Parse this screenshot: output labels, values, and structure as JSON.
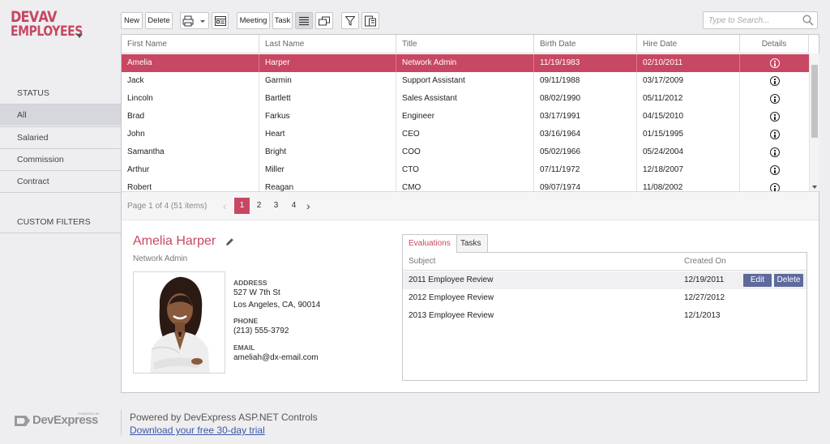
{
  "logo": {
    "line1_a": "DEV",
    "line1_b": "AV",
    "line2": "EMPLOYEES"
  },
  "sidebar": {
    "status_heading": "STATUS",
    "items": [
      {
        "label": "All",
        "active": true
      },
      {
        "label": "Salaried",
        "active": false
      },
      {
        "label": "Commission",
        "active": false
      },
      {
        "label": "Contract",
        "active": false
      }
    ],
    "custom_filters_heading": "CUSTOM FILTERS"
  },
  "toolbar": {
    "new_label": "New",
    "delete_label": "Delete",
    "meeting_label": "Meeting",
    "task_label": "Task"
  },
  "search": {
    "placeholder": "Type to Search..."
  },
  "grid": {
    "columns": [
      "First Name",
      "Last Name",
      "Title",
      "Birth Date",
      "Hire Date",
      "Details"
    ],
    "rows": [
      {
        "first": "Amelia",
        "last": "Harper",
        "title": "Network Admin",
        "birth": "11/19/1983",
        "hire": "02/10/2011",
        "selected": true
      },
      {
        "first": "Jack",
        "last": "Garmin",
        "title": "Support Assistant",
        "birth": "09/11/1988",
        "hire": "03/17/2009"
      },
      {
        "first": "Lincoln",
        "last": "Bartlett",
        "title": "Sales Assistant",
        "birth": "08/02/1990",
        "hire": "05/11/2012"
      },
      {
        "first": "Brad",
        "last": "Farkus",
        "title": "Engineer",
        "birth": "03/17/1991",
        "hire": "04/15/2010"
      },
      {
        "first": "John",
        "last": "Heart",
        "title": "CEO",
        "birth": "03/16/1964",
        "hire": "01/15/1995"
      },
      {
        "first": "Samantha",
        "last": "Bright",
        "title": "COO",
        "birth": "05/02/1966",
        "hire": "05/24/2004"
      },
      {
        "first": "Arthur",
        "last": "Miller",
        "title": "CTO",
        "birth": "07/11/1972",
        "hire": "12/18/2007"
      },
      {
        "first": "Robert",
        "last": "Reagan",
        "title": "CMO",
        "birth": "09/07/1974",
        "hire": "11/08/2002"
      }
    ]
  },
  "pager": {
    "summary": "Page 1 of 4 (51 items)",
    "pages": [
      "1",
      "2",
      "3",
      "4"
    ],
    "current": "1"
  },
  "detail": {
    "name": "Amelia Harper",
    "title": "Network Admin",
    "address_label": "ADDRESS",
    "address_line1": "527 W 7th St",
    "address_line2": "Los Angeles, CA, 90014",
    "phone_label": "PHONE",
    "phone": "(213) 555-3792",
    "email_label": "EMAIL",
    "email": "ameliah@dx-email.com"
  },
  "tabs": {
    "items": [
      "Evaluations",
      "Tasks"
    ],
    "active": "Evaluations",
    "columns": [
      "Subject",
      "Created On"
    ],
    "rows": [
      {
        "subject": "2011 Employee Review",
        "created": "12/19/2011"
      },
      {
        "subject": "2012 Employee Review",
        "created": "12/27/2012"
      },
      {
        "subject": "2013 Employee Review",
        "created": "12/1/2013"
      }
    ],
    "edit_label": "Edit",
    "delete_label": "Delete"
  },
  "footer": {
    "logo_text": "DevExpress",
    "powered_small": "POWERED BY",
    "powered": "Powered by DevExpress ASP.NET Controls",
    "link": "Download your free 30-day trial"
  },
  "colors": {
    "accent": "#c84762",
    "button_blue": "#5e6a9b",
    "link": "#3a57a7"
  }
}
